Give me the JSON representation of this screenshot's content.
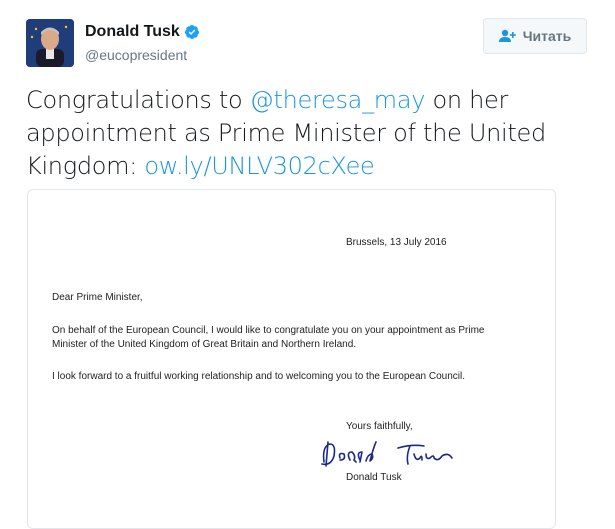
{
  "profile": {
    "name": "Donald Tusk",
    "handle": "@eucopresident",
    "verified": true,
    "avatar_icon": "avatar-photo"
  },
  "follow_button": {
    "label": "Читать",
    "icon": "follow-user-icon"
  },
  "tweet": {
    "text_before": "Congratulations to ",
    "mention": "@theresa_may",
    "text_middle": " on her appointment as Prime Minister of the United Kingdom: ",
    "link": "ow.ly/UNLV302cXee"
  },
  "letter": {
    "date": "Brussels, 13 July 2016",
    "salutation": "Dear Prime Minister,",
    "paragraph1": "On behalf of the European Council, I would like to congratulate you on your appointment as Prime Minister of the United Kingdom of Great Britain and Northern Ireland.",
    "paragraph2": "I look forward to a fruitful working relationship and to welcoming you to the European Council.",
    "closing": "Yours faithfully,",
    "signature_text": "Donald Tusk",
    "signer": "Donald Tusk"
  },
  "colors": {
    "link": "#1b95e0",
    "verified": "#1da1f2",
    "muted": "#657786"
  }
}
